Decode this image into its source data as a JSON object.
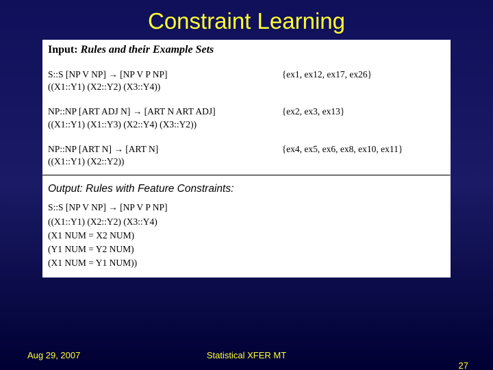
{
  "title": "Constraint Learning",
  "input_label_prefix": "Input:",
  "input_label_rest": "Rules and their Example Sets",
  "rules": [
    {
      "head": "S::S  [NP V NP] → [NP V P NP]",
      "align": "((X1::Y1) (X2::Y2) (X3::Y4))",
      "examples": "{ex1, ex12, ex17, ex26}"
    },
    {
      "head": "NP::NP  [ART ADJ N] → [ART N ART ADJ]",
      "align": "((X1::Y1)  (X1::Y3) (X2::Y4)  (X3::Y2))",
      "examples": "{ex2, ex3, ex13}"
    },
    {
      "head": "NP::NP  [ART N] → [ART N]",
      "align": "((X1::Y1)  (X2::Y2))",
      "examples": "{ex4, ex5, ex6, ex8, ex10, ex11}"
    }
  ],
  "output_label": "Output:  Rules with Feature Constraints:",
  "output_rule": {
    "l1": "S::S  [NP V NP] → [NP V P NP]",
    "l2": "((X1::Y1) (X2::Y2) (X3::Y4)",
    "l3": " (X1 NUM = X2 NUM)",
    "l4": " (Y1 NUM = Y2 NUM)",
    "l5": " (X1 NUM = Y1 NUM))"
  },
  "footer": {
    "date": "Aug 29, 2007",
    "center": "Statistical XFER MT",
    "page": "27"
  }
}
